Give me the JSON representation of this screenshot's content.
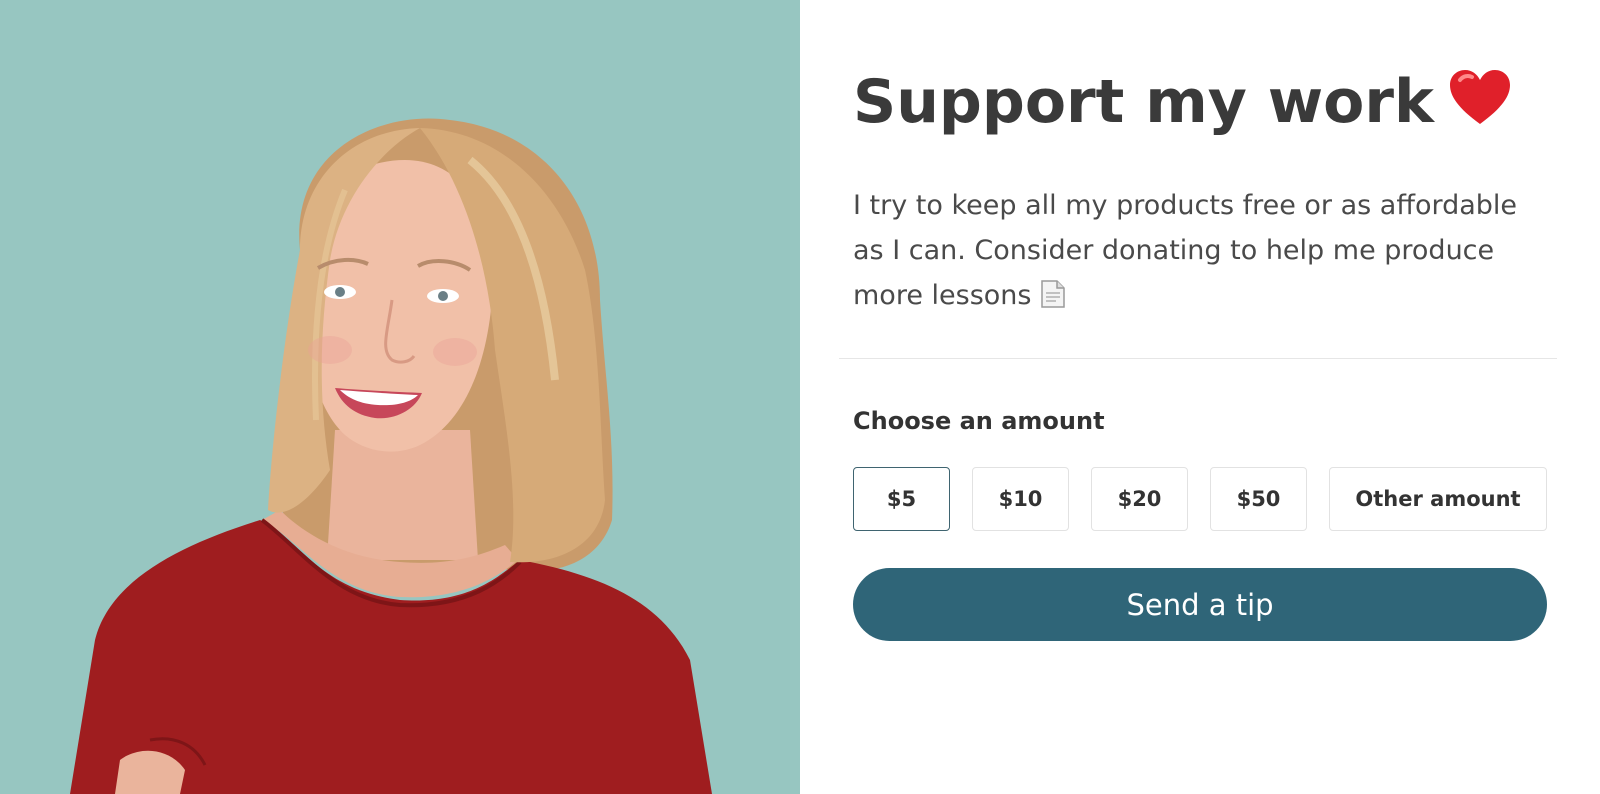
{
  "photo": {
    "alt": "",
    "background_color": "#97c6c1",
    "shirt_color": "#9f1d1f",
    "hair_color": "#d2a979"
  },
  "heading": {
    "title": "Support my work",
    "title_icon": "heart-icon"
  },
  "description": {
    "text": "I try to keep all my products free or as affordable as I can. Consider donating to help me produce more lessons",
    "trailing_icon": "document-icon"
  },
  "amount_picker": {
    "label": "Choose an amount",
    "options": [
      "$5",
      "$10",
      "$20",
      "$50",
      "Other amount"
    ],
    "selected": "$5"
  },
  "submit": {
    "label": "Send a tip"
  },
  "colors": {
    "accent": "#2f6578",
    "selected_border": "#3f6470",
    "heart": "#e0202a",
    "title_text": "#3a3a3a",
    "body_text": "#4a4a4a"
  }
}
